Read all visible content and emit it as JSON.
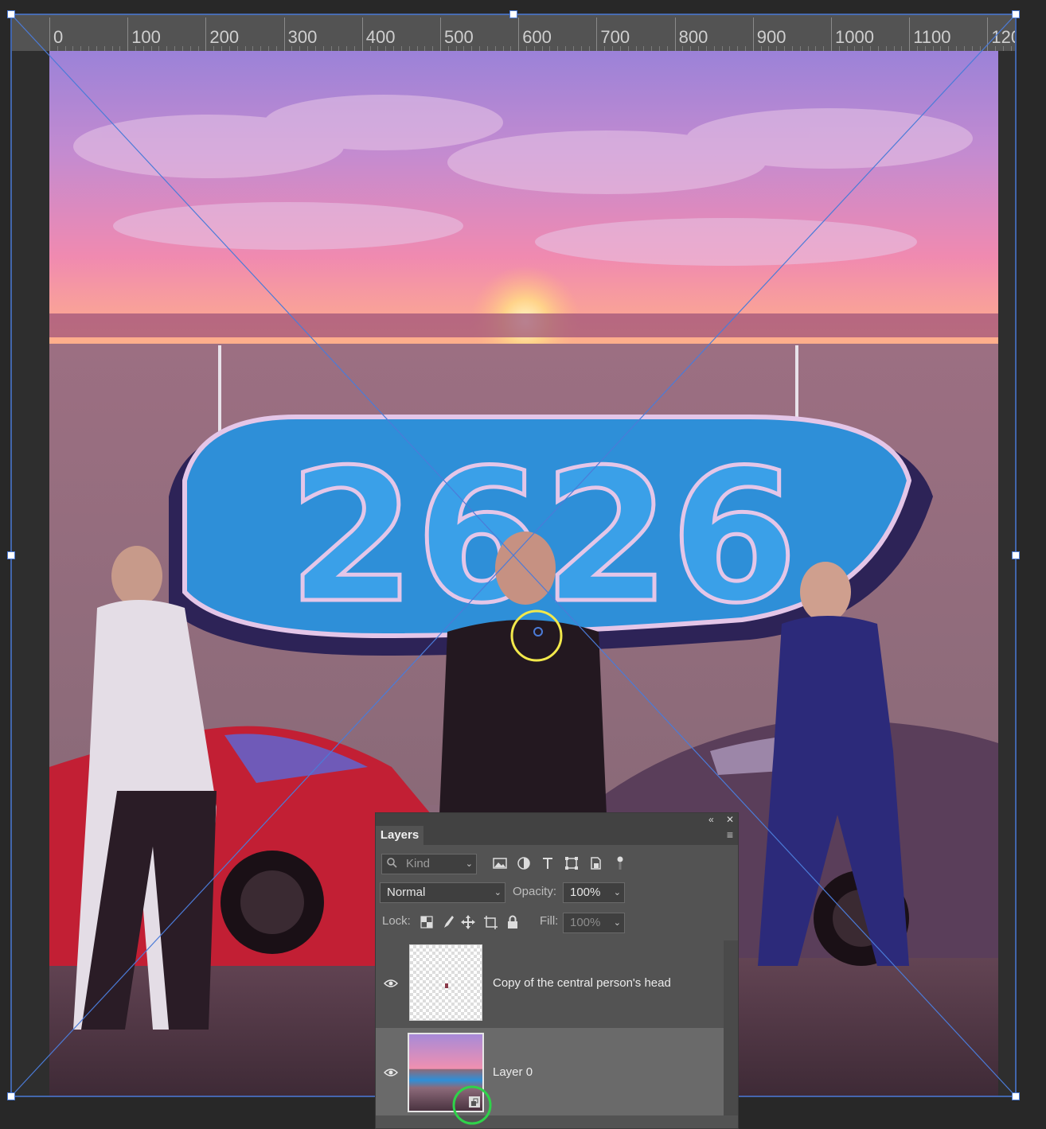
{
  "ruler": {
    "labels": [
      "0",
      "100",
      "200",
      "300",
      "400",
      "500",
      "600",
      "700",
      "800",
      "900",
      "1000",
      "1100",
      "120"
    ]
  },
  "artwork": {
    "graffiti_text": "2626",
    "description_colors": {
      "sky_top": "#9b82d8",
      "sky_mid": "#e87ba8",
      "sun": "#ffd38a",
      "wall": "#8c6a7a",
      "graffiti": "#2e8fd8",
      "ground": "#4a3340"
    }
  },
  "annotations": {
    "yellow_circle_color": "#f2e84b",
    "green_circle_color": "#2fd34a"
  },
  "layers_panel": {
    "tab_label": "Layers",
    "filter_placeholder": "Kind",
    "blend_mode": "Normal",
    "opacity_label": "Opacity:",
    "opacity_value": "100%",
    "lock_label": "Lock:",
    "fill_label": "Fill:",
    "fill_value": "100%",
    "layers": [
      {
        "name": "Copy of the central person's head",
        "visible": true,
        "selected": false
      },
      {
        "name": "Layer 0",
        "visible": true,
        "selected": true
      }
    ]
  },
  "colors": {
    "panel_bg": "#535353",
    "workspace_bg": "#282828",
    "selection_blue": "#4b7bd8"
  }
}
